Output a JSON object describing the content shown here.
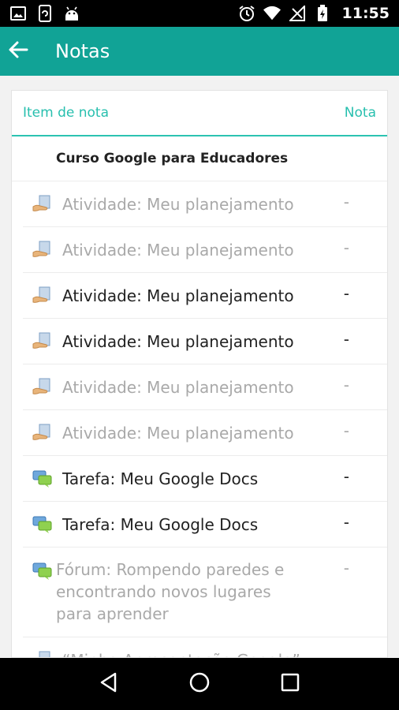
{
  "status_bar": {
    "time": "11:55",
    "left_icons": [
      "image-icon",
      "sync-phone-icon",
      "android-icon"
    ],
    "right_icons": [
      "alarm-icon",
      "wifi-icon",
      "signal-icon",
      "battery-charging-icon"
    ]
  },
  "app_bar": {
    "title": "Notas",
    "back_icon": "arrow-left-icon",
    "color": "#11a396"
  },
  "table": {
    "header_item": "Item de nota",
    "header_grade": "Nota",
    "accent": "#27bfae",
    "course": "Curso Google para Educadores",
    "rows": [
      {
        "icon": "document-hand-icon",
        "label": "Atividade: Meu planejamento",
        "grade": "-",
        "state": "muted"
      },
      {
        "icon": "document-hand-icon",
        "label": "Atividade: Meu planejamento",
        "grade": "-",
        "state": "muted"
      },
      {
        "icon": "document-hand-icon",
        "label": "Atividade: Meu planejamento",
        "grade": "-",
        "state": "dark"
      },
      {
        "icon": "document-hand-icon",
        "label": "Atividade: Meu planejamento",
        "grade": "-",
        "state": "dark"
      },
      {
        "icon": "document-hand-icon",
        "label": "Atividade: Meu planejamento",
        "grade": "-",
        "state": "muted"
      },
      {
        "icon": "document-hand-icon",
        "label": "Atividade: Meu planejamento",
        "grade": "-",
        "state": "muted"
      },
      {
        "icon": "chat-bubbles-icon",
        "label": "Tarefa: Meu Google Docs",
        "grade": "-",
        "state": "dark"
      },
      {
        "icon": "chat-bubbles-icon",
        "label": "Tarefa: Meu Google Docs",
        "grade": "-",
        "state": "dark"
      },
      {
        "icon": "chat-bubbles-icon",
        "label": "Fórum: Rompendo paredes e encontrando novos lugares para aprender",
        "grade": "-",
        "state": "muted"
      },
      {
        "icon": "document-icon",
        "label": "“Minha Apresentação Google”",
        "grade": "",
        "state": "muted"
      }
    ]
  },
  "nav_bar": {
    "buttons": [
      "back-triangle-icon",
      "home-circle-icon",
      "recents-square-icon"
    ]
  }
}
